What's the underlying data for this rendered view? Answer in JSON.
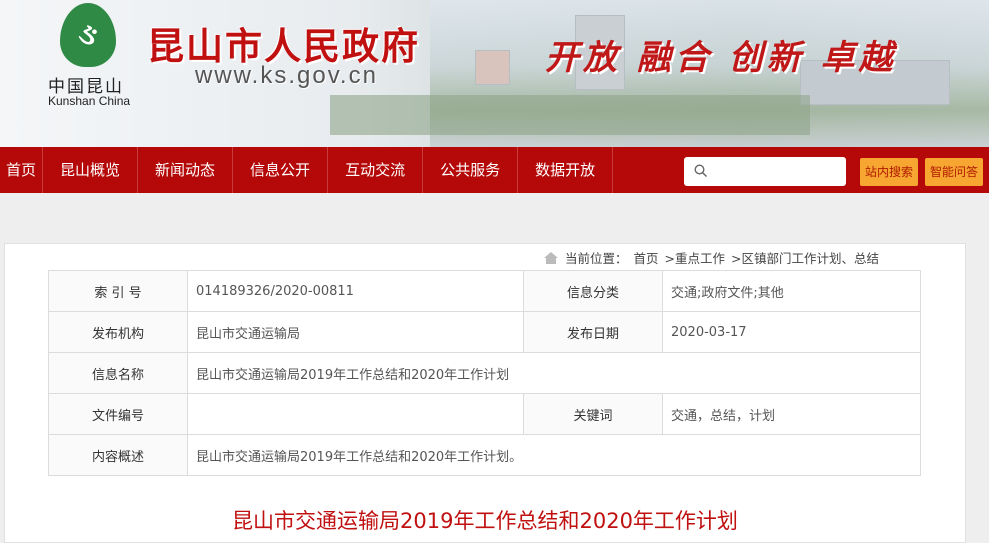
{
  "header": {
    "logo_cn": "中国昆山",
    "logo_en": "Kunshan China",
    "title": "昆山市人民政府",
    "url": "www.ks.gov.cn",
    "slogan": "开放 融合 创新 卓越"
  },
  "nav": {
    "items": [
      "首页",
      "昆山概览",
      "新闻动态",
      "信息公开",
      "互动交流",
      "公共服务",
      "数据开放"
    ],
    "search_placeholder": "",
    "search_button": "站内搜索",
    "qa_button": "智能问答"
  },
  "breadcrumb": {
    "label": "当前位置：",
    "items": [
      "首页",
      ">重点工作",
      ">区镇部门工作计划、总结"
    ]
  },
  "info_table": {
    "index_label": "索 引 号",
    "index_value": "014189326/2020-00811",
    "category_label": "信息分类",
    "category_value": "交通;政府文件;其他",
    "publisher_label": "发布机构",
    "publisher_value": "昆山市交通运输局",
    "date_label": "发布日期",
    "date_value": "2020-03-17",
    "name_label": "信息名称",
    "name_value": "昆山市交通运输局2019年工作总结和2020年工作计划",
    "docno_label": "文件编号",
    "docno_value": "",
    "keywords_label": "关键词",
    "keywords_value": "交通，总结，计划",
    "summary_label": "内容概述",
    "summary_value": "昆山市交通运输局2019年工作总结和2020年工作计划。"
  },
  "document": {
    "title": "昆山市交通运输局2019年工作总结和2020年工作计划"
  },
  "colors": {
    "nav": "#b50909",
    "accent": "#c01010",
    "button": "#f7a632"
  }
}
